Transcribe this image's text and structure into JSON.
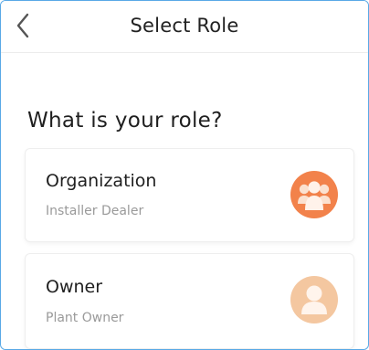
{
  "header": {
    "title": "Select Role"
  },
  "main": {
    "question": "What is your role?",
    "roles": [
      {
        "label": "Organization",
        "subtitle": "Installer Dealer",
        "icon": "group-icon",
        "color": "#f2824b"
      },
      {
        "label": "Owner",
        "subtitle": "Plant Owner",
        "icon": "person-icon",
        "color": "#f4c7a0"
      }
    ]
  },
  "colors": {
    "frame_border": "#59a9e6",
    "title": "#222222",
    "subtitle": "#9a9a9a"
  }
}
